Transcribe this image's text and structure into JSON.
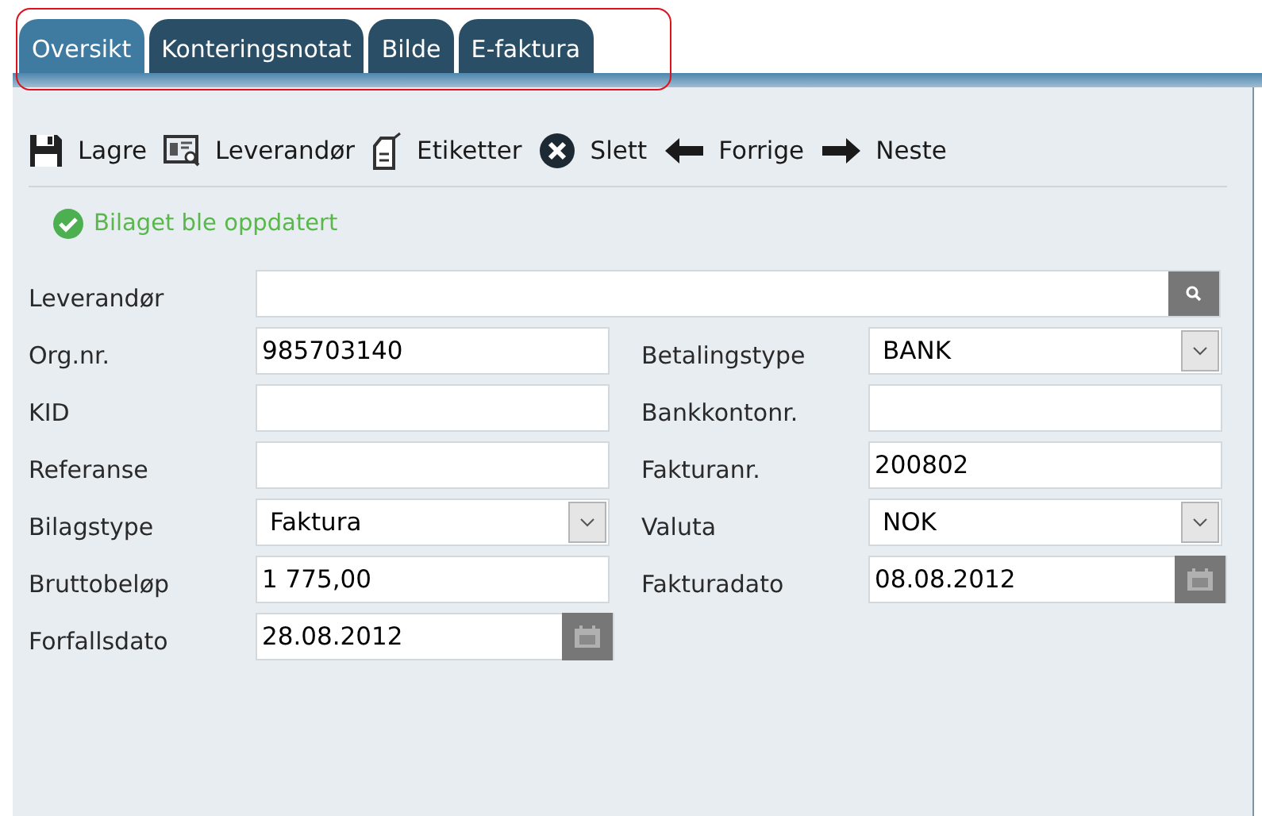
{
  "tabs": [
    {
      "label": "Oversikt",
      "selected": true
    },
    {
      "label": "Konteringsnotat",
      "selected": false
    },
    {
      "label": "Bilde",
      "selected": false
    },
    {
      "label": "E-faktura",
      "selected": false
    }
  ],
  "toolbar": [
    {
      "label": "Lagre",
      "kind": "save"
    },
    {
      "label": "Leverandør",
      "kind": "supplier"
    },
    {
      "label": "Etiketter",
      "kind": "tag"
    },
    {
      "label": "Slett",
      "kind": "delete"
    },
    {
      "label": "Forrige",
      "kind": "prev"
    },
    {
      "label": "Neste",
      "kind": "next"
    }
  ],
  "message": {
    "text": "Bilaget ble oppdatert",
    "kind": "success"
  },
  "supplier_field": {
    "label": "Leverandør",
    "kind": "search"
  },
  "left_fields": [
    {
      "label": "Org.nr.",
      "value": "985703140",
      "kind": "text"
    },
    {
      "label": "KID",
      "kind": "text"
    },
    {
      "label": "Referanse",
      "kind": "text"
    },
    {
      "label": "Bilagstype",
      "value": "Faktura",
      "kind": "select"
    },
    {
      "label": "Bruttobeløp",
      "value": "1 775,00",
      "kind": "text"
    },
    {
      "label": "Forfallsdato",
      "value": "28.08.2012",
      "kind": "date"
    }
  ],
  "right_fields": [
    {
      "label": "Betalingstype",
      "value": "BANK",
      "kind": "select"
    },
    {
      "label": "Bankkontonr.",
      "kind": "text"
    },
    {
      "label": "Fakturanr.",
      "value": "200802",
      "kind": "text"
    },
    {
      "label": "Valuta",
      "value": "NOK",
      "kind": "select"
    },
    {
      "label": "Fakturadato",
      "value": "08.08.2012",
      "kind": "date"
    }
  ]
}
